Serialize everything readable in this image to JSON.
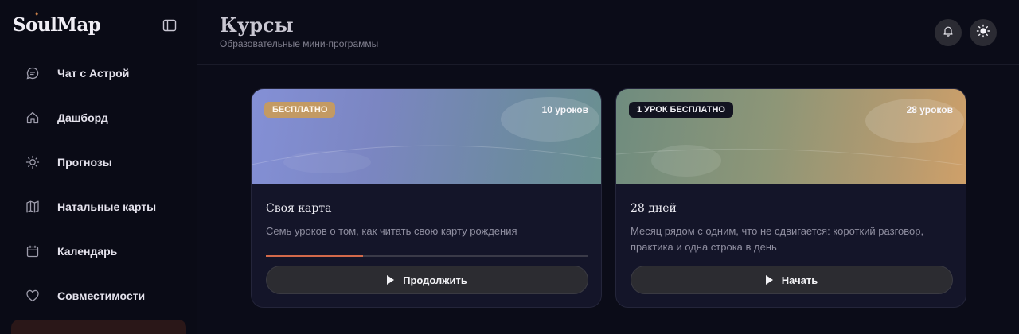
{
  "app": {
    "logo": "SoulMap",
    "logo_star": "✦"
  },
  "sidebar": {
    "items": [
      {
        "label": "Чат с Астрой",
        "icon": "chat-icon"
      },
      {
        "label": "Дашборд",
        "icon": "home-icon"
      },
      {
        "label": "Прогнозы",
        "icon": "sun-icon"
      },
      {
        "label": "Натальные карты",
        "icon": "map-icon"
      },
      {
        "label": "Календарь",
        "icon": "calendar-icon"
      },
      {
        "label": "Совместимости",
        "icon": "heart-icon"
      }
    ]
  },
  "header": {
    "title": "Курсы",
    "subtitle": "Образовательные мини-программы",
    "buttons": [
      "bell-icon",
      "sun-icon"
    ]
  },
  "courses": [
    {
      "badge": "БЕСПЛАТНО",
      "lessons": "10 уроков",
      "title": "Своя карта",
      "description": "Семь уроков о том, как читать свою карту рождения",
      "progress": 0.3,
      "action": "Продолжить"
    },
    {
      "badge": "1 УРОК БЕСПЛАТНО",
      "lessons": "28 уроков",
      "title": "28 дней",
      "description": "Месяц рядом с одним, что не сдвигается: короткий разговор, практика и одна строка в день",
      "action": "Начать"
    }
  ],
  "colors": {
    "background": "#0b0c18",
    "accent": "#d2694a",
    "badge_gold": "#c39a63"
  }
}
